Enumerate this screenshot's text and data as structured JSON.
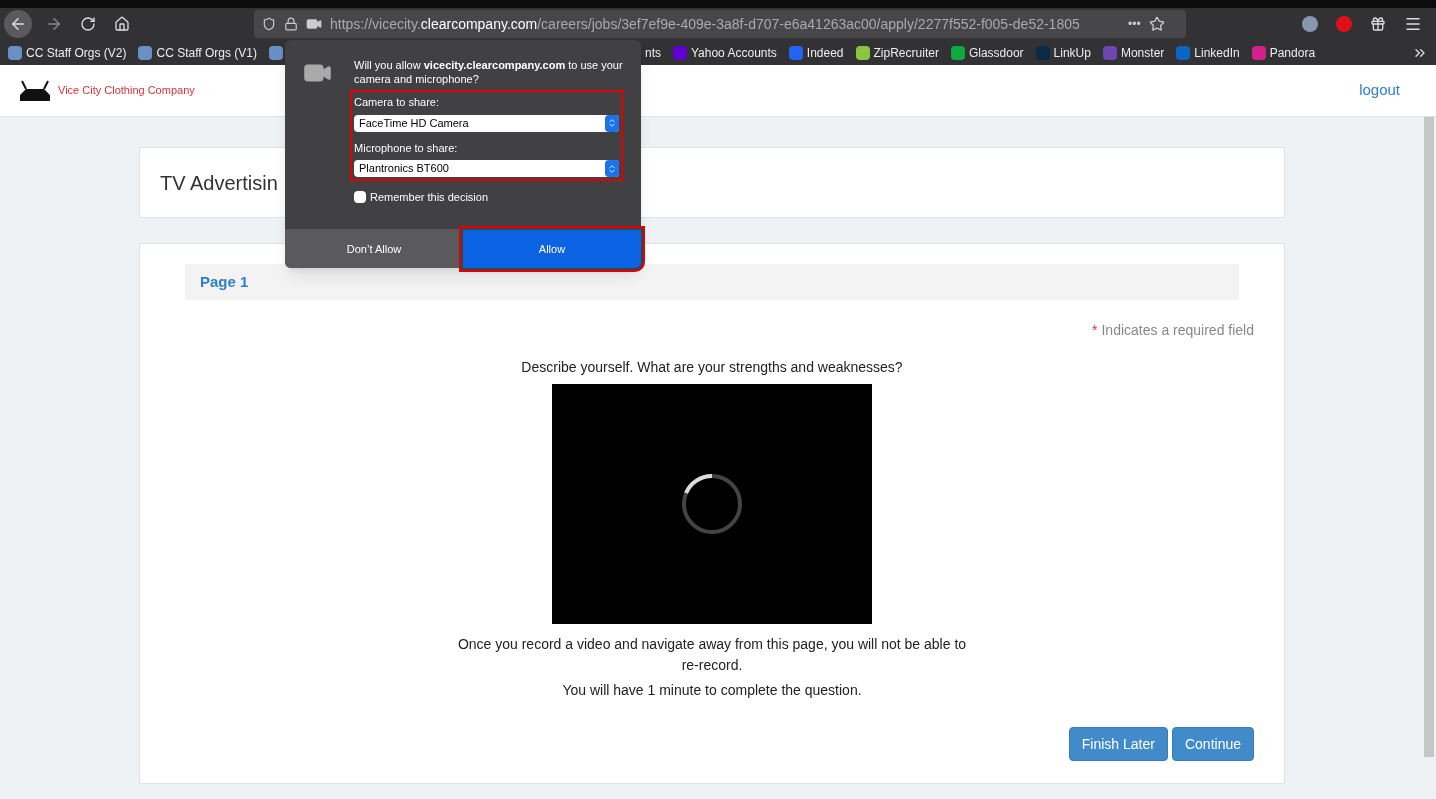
{
  "browser": {
    "url_prefix": "https://vicecity.",
    "url_domain": "clearcompany.com",
    "url_rest": "/careers/jobs/3ef7ef9e-409e-3a8f-d707-e6a41263ac00/apply/2277f552-f005-de52-1805",
    "more": "•••"
  },
  "bookmarks": [
    {
      "label": "CC Staff Orgs (V2)"
    },
    {
      "label": "CC Staff Orgs (V1)"
    },
    {
      "label": "nts"
    },
    {
      "label": "Yahoo Accounts"
    },
    {
      "label": "Indeed"
    },
    {
      "label": "ZipRecruiter"
    },
    {
      "label": "Glassdoor"
    },
    {
      "label": "LinkUp"
    },
    {
      "label": "Monster"
    },
    {
      "label": "LinkedIn"
    },
    {
      "label": "Pandora"
    }
  ],
  "header": {
    "logo_text": "Vice City Clothing Company",
    "logout": "logout"
  },
  "job_title": "TV Advertisin",
  "form": {
    "page_tab": "Page 1",
    "required_mark": "*",
    "required_note": "Indicates a required field",
    "question": "Describe yourself. What are your strengths and weaknesses?",
    "note_1": "Once you record a video and navigate away from this page, you will not be able to re-record.",
    "note_2": "You will have 1 minute to complete the question.",
    "buttons": [
      "Finish Later",
      "Continue"
    ]
  },
  "permission_popup": {
    "prompt_start": "Will you allow ",
    "prompt_site": "vicecity.clearcompany.com",
    "prompt_end": " to use your camera and microphone?",
    "camera_label": "Camera to share:",
    "camera_value": "FaceTime HD Camera",
    "mic_label": "Microphone to share:",
    "mic_value": "Plantronics BT600",
    "remember_label": "Remember this decision",
    "remember_checked": false,
    "deny": "Don’t Allow",
    "allow": "Allow"
  }
}
